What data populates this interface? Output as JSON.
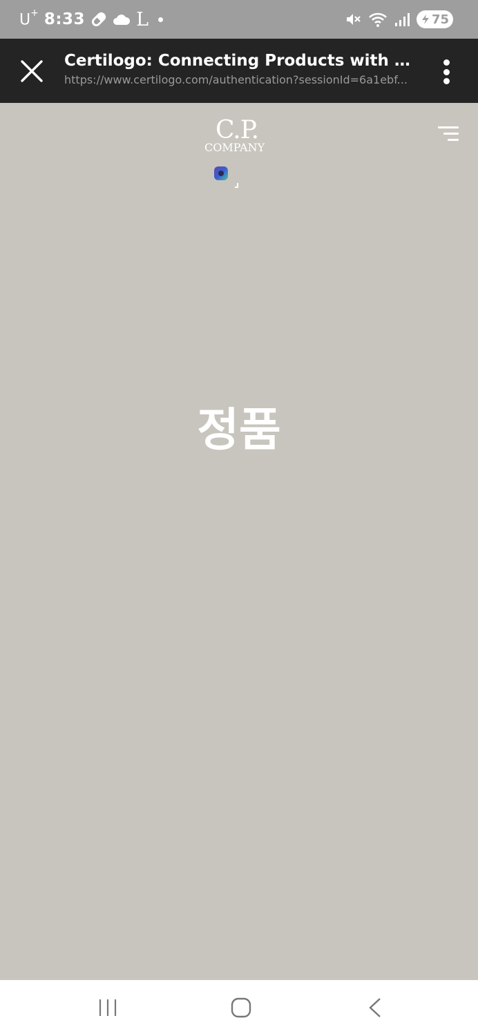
{
  "status_bar": {
    "carrier": "U",
    "carrier_sup": "+",
    "time": "8:33",
    "letter_icon": "L",
    "battery": "75",
    "icons": [
      "pill-icon",
      "cloud-icon",
      "mute-icon",
      "wifi-icon",
      "signal-icon",
      "battery-icon"
    ]
  },
  "browser": {
    "title": "Certilogo: Connecting Products with People",
    "url": "https://www.certilogo.com/authentication?sessionId=6a1ebf..."
  },
  "page": {
    "logo_top": "C.P.",
    "logo_bottom": "COMPANY",
    "result": "정품"
  },
  "colors": {
    "status_bar_bg": "#9e9e9e",
    "browser_bar_bg": "#242424",
    "page_bg": "#c8c5be",
    "nav_bar_bg": "#ffffff"
  }
}
